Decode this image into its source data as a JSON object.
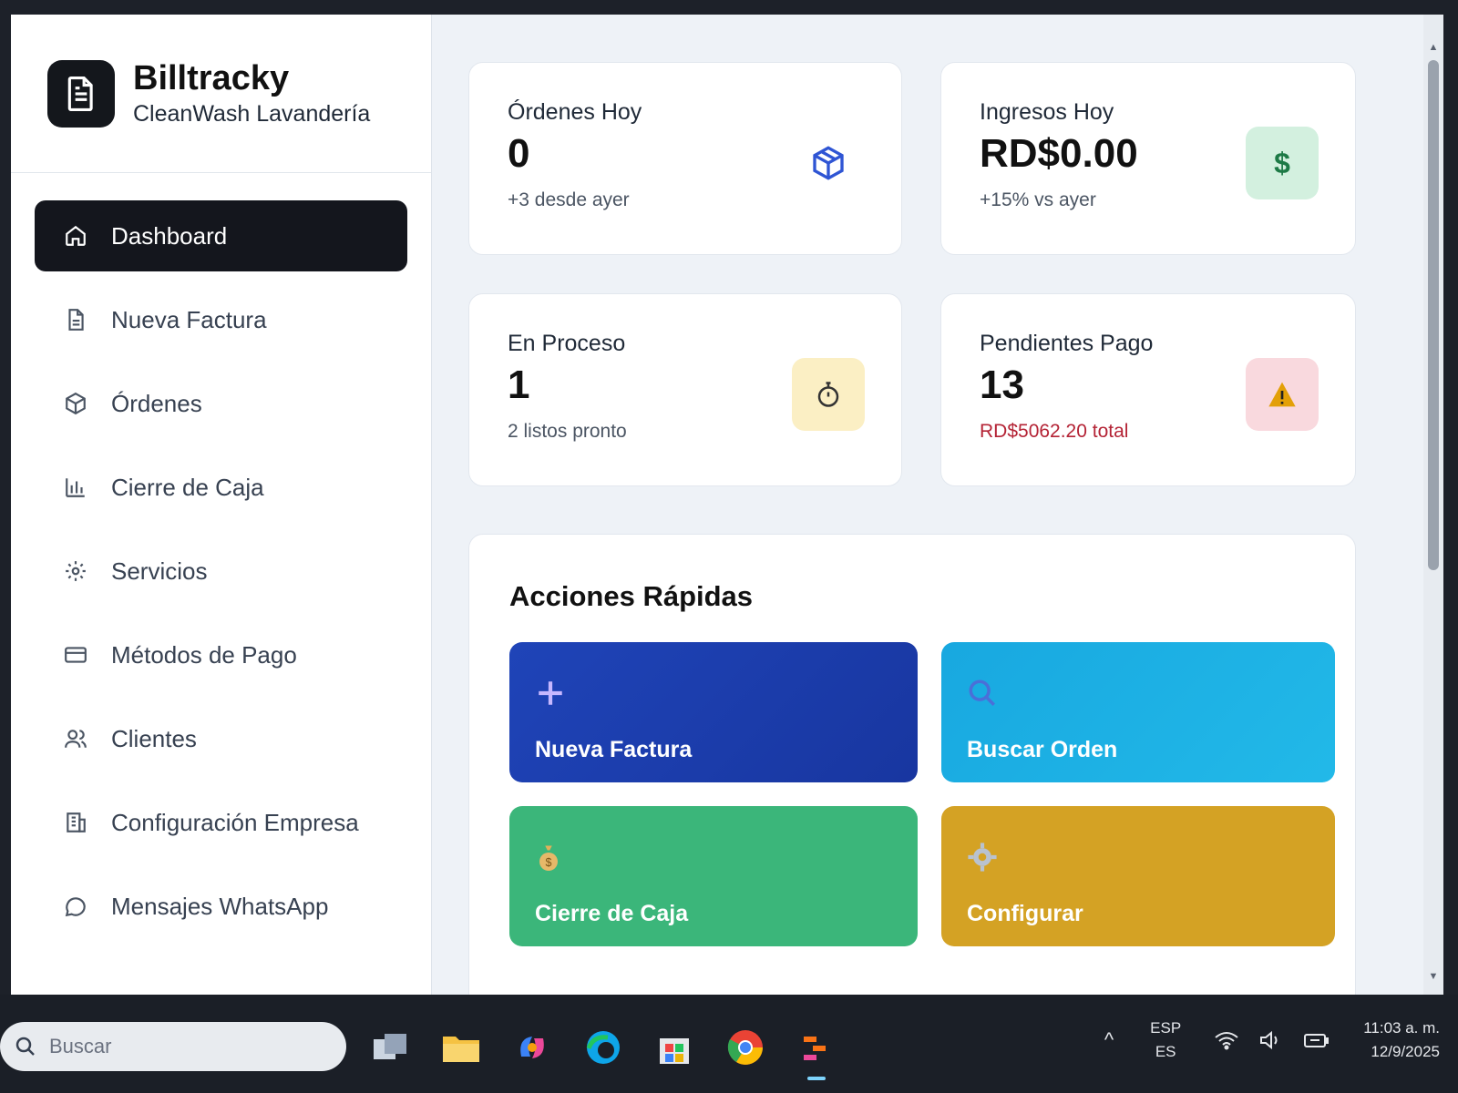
{
  "brand": {
    "name": "Billtracky",
    "subtitle": "CleanWash Lavandería"
  },
  "sidebar": {
    "items": [
      {
        "label": "Dashboard",
        "icon": "home-icon",
        "active": true
      },
      {
        "label": "Nueva Factura",
        "icon": "document-icon"
      },
      {
        "label": "Órdenes",
        "icon": "package-icon"
      },
      {
        "label": "Cierre de Caja",
        "icon": "bar-chart-icon"
      },
      {
        "label": "Servicios",
        "icon": "gear-icon"
      },
      {
        "label": "Métodos de Pago",
        "icon": "credit-card-icon"
      },
      {
        "label": "Clientes",
        "icon": "users-icon"
      },
      {
        "label": "Configuración Empresa",
        "icon": "building-icon"
      },
      {
        "label": "Mensajes WhatsApp",
        "icon": "chat-bubble-icon"
      }
    ]
  },
  "stats": [
    {
      "title": "Órdenes Hoy",
      "value": "0",
      "note": "+3 desde ayer",
      "icon": "package-icon",
      "color": "#2f55d4"
    },
    {
      "title": "Ingresos Hoy",
      "value": "RD$0.00",
      "note": "+15% vs ayer",
      "icon": "dollar-icon",
      "color": "#2f8f5a"
    },
    {
      "title": "En Proceso",
      "value": "1",
      "note": "2 listos pronto",
      "icon": "stopwatch-icon",
      "color": "#d9a520"
    },
    {
      "title": "Pendientes Pago",
      "value": "13",
      "note": "RD$5062.20 total",
      "icon": "warning-icon",
      "color": "#b42335"
    }
  ],
  "quick_actions": {
    "title": "Acciones Rápidas",
    "buttons": [
      {
        "label": "Nueva Factura",
        "icon": "plus-icon",
        "color": "#1f44b8"
      },
      {
        "label": "Buscar Orden",
        "icon": "search-icon",
        "color": "#18a8e0"
      },
      {
        "label": "Cierre de Caja",
        "icon": "money-bag-icon",
        "color": "#3bb67a"
      },
      {
        "label": "Configurar",
        "icon": "gear-icon",
        "color": "#d4a224"
      }
    ]
  },
  "taskbar": {
    "search_placeholder": "Buscar",
    "lang_top": "ESP",
    "lang_bottom": "ES",
    "time": "11:03 a. m.",
    "date": "12/9/2025"
  }
}
